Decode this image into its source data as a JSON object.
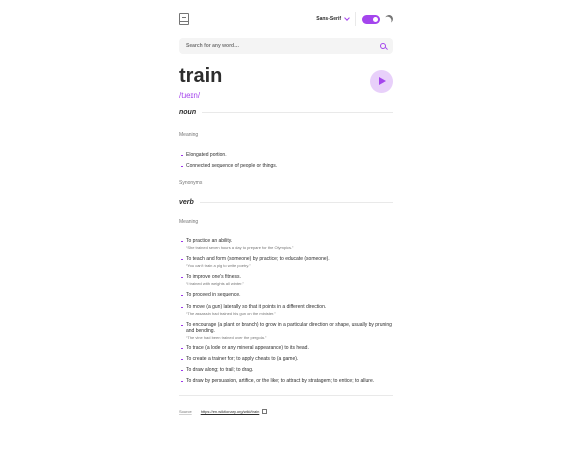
{
  "header": {
    "logo_icon": "book-icon",
    "font_label": "Sans-Serif",
    "theme_toggle_on": true,
    "moon_icon": "moon-icon"
  },
  "search": {
    "placeholder": "Search for any word…",
    "value": ""
  },
  "entry": {
    "word": "train",
    "phonetic": "/tɹeɪn/"
  },
  "noun": {
    "pos": "noun",
    "meaning_label": "Meaning",
    "definitions": [
      "Elongated portion.",
      "Connected sequence of people or things."
    ],
    "synonyms_label": "Synonyms"
  },
  "verb": {
    "pos": "verb",
    "meaning_label": "Meaning",
    "definitions": [
      {
        "text": "To practice an ability.",
        "example": "“She trained seven hours a day to prepare for the Olympics.”"
      },
      {
        "text": "To teach and form (someone) by practice; to educate (someone).",
        "example": "“You can't train a pig to write poetry.”"
      },
      {
        "text": "To improve one's fitness.",
        "example": "“I trained with weights all winter.”"
      },
      {
        "text": "To proceed in sequence.",
        "example": ""
      },
      {
        "text": "To move (a gun) laterally so that it points in a different direction.",
        "example": "“The assassin had trained his gun on the minister.”"
      },
      {
        "text": "To encourage (a plant or branch) to grow in a particular direction or shape, usually by pruning and bending.",
        "example": "“The vine had been trained over the pergola.”"
      },
      {
        "text": "To trace (a lode or any mineral appearance) to its head.",
        "example": ""
      },
      {
        "text": "To create a trainer for; to apply cheats to (a game).",
        "example": ""
      },
      {
        "text": "To draw along; to trail; to drag.",
        "example": ""
      },
      {
        "text": "To draw by persuasion, artifice, or the like; to attract by stratagem; to entice; to allure.",
        "example": ""
      }
    ]
  },
  "source": {
    "label": "Source",
    "url": "https://en.wiktionary.org/wiki/train"
  },
  "colors": {
    "accent": "#a445ed",
    "text": "#2d2d2d",
    "muted": "#757575",
    "search_bg": "#f4f4f4"
  }
}
